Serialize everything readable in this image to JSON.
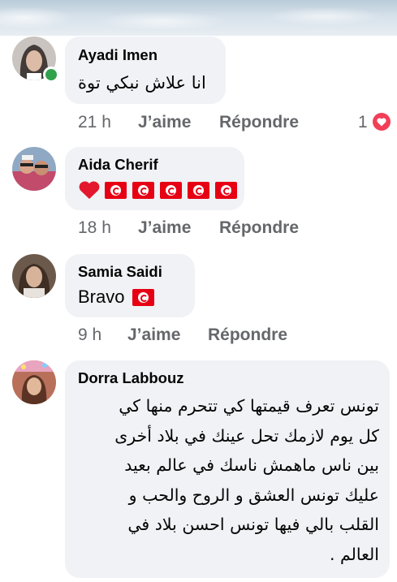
{
  "comments": [
    {
      "author": "Ayadi Imen",
      "text": "انا علاش نبكي توة",
      "time": "21 h",
      "like_label": "J’aime",
      "reply_label": "Répondre",
      "reaction_count": "1",
      "online": true
    },
    {
      "author": "Aida Cherif",
      "emoji": [
        "red-heart",
        "tunisia-flag",
        "tunisia-flag",
        "tunisia-flag",
        "tunisia-flag",
        "tunisia-flag"
      ],
      "time": "18 h",
      "like_label": "J’aime",
      "reply_label": "Répondre"
    },
    {
      "author": "Samia Saidi",
      "text": "Bravo",
      "emoji": [
        "tunisia-flag"
      ],
      "time": "9 h",
      "like_label": "J’aime",
      "reply_label": "Répondre"
    },
    {
      "author": "Dorra Labbouz",
      "lines": [
        "تونس تعرف قيمتها كي تتحرم منها كي",
        "كل يوم لازمك تحل عينك في بلاد أخرى",
        "بين ناس ماهمش ناسك في عالم بعيد",
        "عليك تونس العشق و الروح والحب و",
        "القلب بالي فيها تونس احسن بلاد في",
        "العالم ."
      ]
    }
  ],
  "colors": {
    "bubble": "#f0f2f5",
    "meta": "#65676b",
    "heart_reaction": "#f33e58",
    "online": "#31a24c",
    "tunisia_red": "#e70013"
  }
}
